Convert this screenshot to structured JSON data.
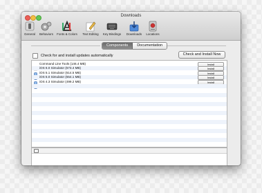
{
  "window": {
    "title": "Downloads"
  },
  "toolbar": {
    "items": [
      {
        "label": "General",
        "icon": "switch-icon"
      },
      {
        "label": "Behaviors",
        "icon": "gears-icon"
      },
      {
        "label": "Fonts & Colors",
        "icon": "letter-a-icon"
      },
      {
        "label": "Text Editing",
        "icon": "pencil-paper-icon"
      },
      {
        "label": "Key Bindings",
        "icon": "keyboard-icon"
      },
      {
        "label": "Downloads",
        "icon": "download-box-icon"
      },
      {
        "label": "Locations",
        "icon": "hard-drive-icon"
      }
    ]
  },
  "tabs": {
    "components": "Components",
    "documentation": "Documentation"
  },
  "updates": {
    "checkbox_label": "Check for and install updates automatically",
    "button": "Check and Install Now"
  },
  "components": [
    {
      "label": "Command Line Tools (146.4 MB)",
      "action": "Install"
    },
    {
      "label": "iOS 6.0 Simulator (573.4 MB)",
      "action": "Install"
    },
    {
      "label": "iOS 5.1 Simulator (614.5 MB)",
      "action": "Install"
    },
    {
      "label": "iOS 5.0 Simulator (554.1 MB)",
      "action": "Install"
    },
    {
      "label": "iOS 4.3 Simulator (499.2 MB)",
      "action": "Install"
    }
  ],
  "colors": {
    "selection": "#6b6b6b",
    "row_alt": "#eef3fb"
  }
}
